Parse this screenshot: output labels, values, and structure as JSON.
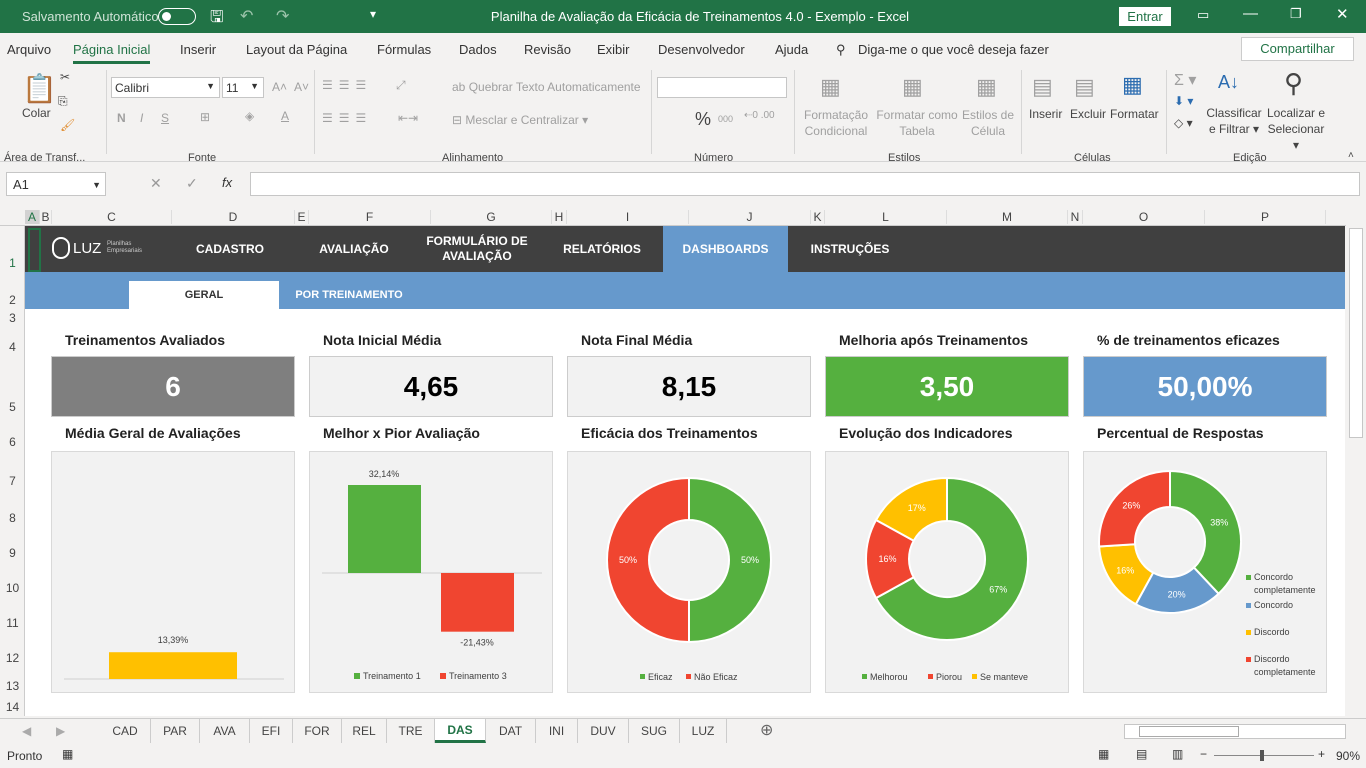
{
  "titlebar": {
    "autosave": "Salvamento Automático",
    "title": "Planilha de Avaliação da Eficácia de Treinamentos 4.0 - Exemplo  -  Excel",
    "signin": "Entrar"
  },
  "menu": [
    "Arquivo",
    "Página Inicial",
    "Inserir",
    "Layout da Página",
    "Fórmulas",
    "Dados",
    "Revisão",
    "Exibir",
    "Desenvolvedor",
    "Ajuda"
  ],
  "tell_me": "Diga-me o que você deseja fazer",
  "share": "Compartilhar",
  "ribbon": {
    "paste": "Colar",
    "font_name": "Calibri",
    "font_size": "11",
    "bold": "N",
    "italic": "I",
    "underline": "S",
    "wrap": "Quebrar Texto Automaticamente",
    "merge": "Mesclar e Centralizar",
    "cond1": "Formatação",
    "cond2": "Condicional",
    "table1": "Formatar como",
    "table2": "Tabela",
    "cell1": "Estilos de",
    "cell2": "Célula",
    "insert": "Inserir",
    "delete": "Excluir",
    "format": "Formatar",
    "sort1": "Classificar",
    "sort2": "e Filtrar",
    "find1": "Localizar e",
    "find2": "Selecionar",
    "groups": [
      "Área de Transf...",
      "Fonte",
      "Alinhamento",
      "Número",
      "Estilos",
      "Células",
      "Edição"
    ]
  },
  "formula": {
    "namebox": "A1",
    "fx": "fx",
    "value": ""
  },
  "columns": [
    "A",
    "B",
    "C",
    "D",
    "E",
    "F",
    "G",
    "H",
    "I",
    "J",
    "K",
    "L",
    "M",
    "N",
    "O",
    "P"
  ],
  "rows": [
    "1",
    "2",
    "3",
    "4",
    "5",
    "6",
    "7",
    "8",
    "9",
    "10",
    "11",
    "12",
    "13",
    "14"
  ],
  "dashboard": {
    "logo": "LUZ",
    "logo_sub": "Planilhas Empresariais",
    "nav": [
      "CADASTRO",
      "AVALIAÇÃO",
      "FORMULÁRIO DE AVALIAÇÃO",
      "RELATÓRIOS",
      "DASHBOARDS",
      "INSTRUÇÕES"
    ],
    "subnav": [
      "GERAL",
      "POR TREINAMENTO"
    ],
    "kpis": [
      {
        "title": "Treinamentos Avaliados",
        "value": "6",
        "bg": "#7f7f7f",
        "fg": "#ffffff"
      },
      {
        "title": "Nota Inicial Média",
        "value": "4,65",
        "bg": "#f2f2f2",
        "fg": "#000000"
      },
      {
        "title": "Nota Final Média",
        "value": "8,15",
        "bg": "#f2f2f2",
        "fg": "#000000"
      },
      {
        "title": "Melhoria após Treinamentos",
        "value": "3,50",
        "bg": "#55b03f",
        "fg": "#ffffff"
      },
      {
        "title": "% de treinamentos eficazes",
        "value": "50,00%",
        "bg": "#6699cc",
        "fg": "#ffffff"
      }
    ],
    "chart_titles": [
      "Média Geral de Avaliações",
      "Melhor x Pior Avaliação",
      "Eficácia dos Treinamentos",
      "Evolução dos Indicadores",
      "Percentual de Respostas"
    ]
  },
  "chart_data": [
    {
      "type": "bar",
      "values": [
        13.39
      ],
      "labels": [
        "13,39%"
      ],
      "colors": [
        "#ffc000"
      ]
    },
    {
      "type": "bar",
      "series": [
        {
          "name": "Treinamento 1",
          "values": [
            32.14
          ],
          "label": "32,14%",
          "color": "#55b03f"
        },
        {
          "name": "Treinamento 3",
          "values": [
            -21.43
          ],
          "label": "-21,43%",
          "color": "#f04530"
        }
      ],
      "legend": "bottom"
    },
    {
      "type": "pie",
      "donut": true,
      "slices": [
        {
          "name": "Eficaz",
          "value": 50,
          "label": "50%",
          "color": "#55b03f"
        },
        {
          "name": "Não Eficaz",
          "value": 50,
          "label": "50%",
          "color": "#f04530"
        }
      ],
      "legend": "bottom"
    },
    {
      "type": "pie",
      "donut": true,
      "slices": [
        {
          "name": "Melhorou",
          "value": 67,
          "label": "67%",
          "color": "#55b03f"
        },
        {
          "name": "Piorou",
          "value": 16,
          "label": "16%",
          "color": "#f04530"
        },
        {
          "name": "Se manteve",
          "value": 17,
          "label": "17%",
          "color": "#ffc000"
        }
      ],
      "legend": "bottom"
    },
    {
      "type": "pie",
      "donut": true,
      "slices": [
        {
          "name": "Concordo completamente",
          "value": 38,
          "label": "38%",
          "color": "#55b03f"
        },
        {
          "name": "Concordo",
          "value": 20,
          "label": "20%",
          "color": "#6699cc"
        },
        {
          "name": "Discordo",
          "value": 16,
          "label": "16%",
          "color": "#ffc000"
        },
        {
          "name": "Discordo completamente",
          "value": 26,
          "label": "26%",
          "color": "#f04530"
        }
      ],
      "legend": "right"
    }
  ],
  "sheets": [
    "CAD",
    "PAR",
    "AVA",
    "EFI",
    "FOR",
    "REL",
    "TRE",
    "DAS",
    "DAT",
    "INI",
    "DUV",
    "SUG",
    "LUZ"
  ],
  "active_sheet": "DAS",
  "status": {
    "ready": "Pronto",
    "zoom": "90%"
  }
}
